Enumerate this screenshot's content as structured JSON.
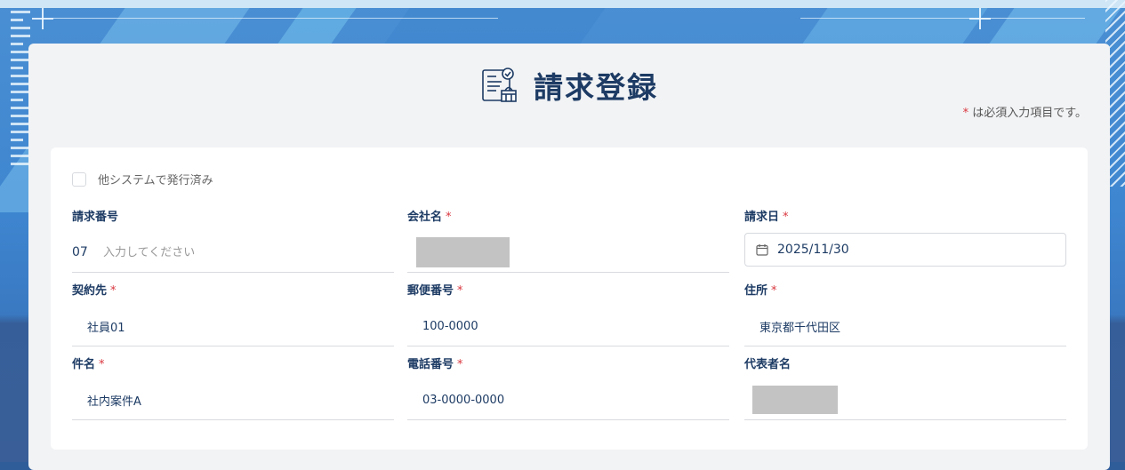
{
  "page": {
    "title": "請求登録",
    "required_note_star": "*",
    "required_note_text": "は必須入力項目です。"
  },
  "form": {
    "issued_elsewhere": {
      "label": "他システムで発行済み",
      "checked": false
    },
    "invoice_number": {
      "label": "請求番号",
      "prefix": "07",
      "value": "",
      "placeholder": "入力してください"
    },
    "company_name": {
      "label": "会社名",
      "required_mark": "*"
    },
    "invoice_date": {
      "label": "請求日",
      "required_mark": "*",
      "value": "2025/11/30"
    },
    "contractor": {
      "label": "契約先",
      "required_mark": "*",
      "value": "社員01"
    },
    "postal_code": {
      "label": "郵便番号",
      "required_mark": "*",
      "value": "100-0000"
    },
    "address": {
      "label": "住所",
      "required_mark": "*",
      "value": "東京都千代田区"
    },
    "subject": {
      "label": "件名",
      "required_mark": "*",
      "value": "社内案件A"
    },
    "phone": {
      "label": "電話番号",
      "required_mark": "*",
      "value": "03-0000-0000"
    },
    "representative": {
      "label": "代表者名"
    }
  },
  "icons": {
    "title": "invoice-document-icon",
    "date": "calendar-icon"
  },
  "colors": {
    "accent": "#1d3b64",
    "required": "#d9363e",
    "panel": "#f2f3f5"
  }
}
